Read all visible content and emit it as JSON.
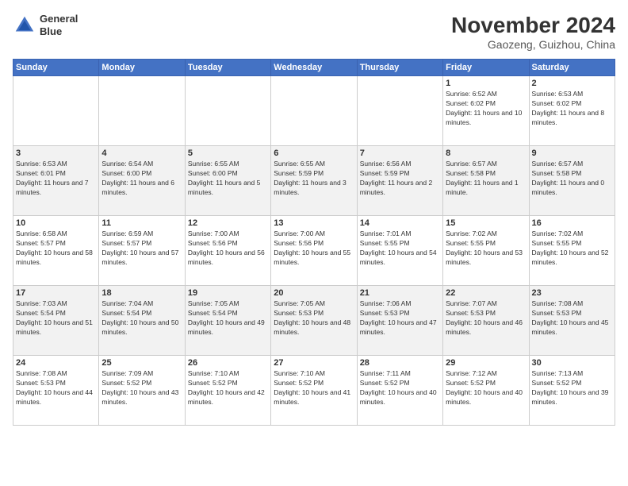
{
  "header": {
    "logo_line1": "General",
    "logo_line2": "Blue",
    "month": "November 2024",
    "location": "Gaozeng, Guizhou, China"
  },
  "weekdays": [
    "Sunday",
    "Monday",
    "Tuesday",
    "Wednesday",
    "Thursday",
    "Friday",
    "Saturday"
  ],
  "weeks": [
    [
      {
        "day": "",
        "info": ""
      },
      {
        "day": "",
        "info": ""
      },
      {
        "day": "",
        "info": ""
      },
      {
        "day": "",
        "info": ""
      },
      {
        "day": "",
        "info": ""
      },
      {
        "day": "1",
        "info": "Sunrise: 6:52 AM\nSunset: 6:02 PM\nDaylight: 11 hours and 10 minutes."
      },
      {
        "day": "2",
        "info": "Sunrise: 6:53 AM\nSunset: 6:02 PM\nDaylight: 11 hours and 8 minutes."
      }
    ],
    [
      {
        "day": "3",
        "info": "Sunrise: 6:53 AM\nSunset: 6:01 PM\nDaylight: 11 hours and 7 minutes."
      },
      {
        "day": "4",
        "info": "Sunrise: 6:54 AM\nSunset: 6:00 PM\nDaylight: 11 hours and 6 minutes."
      },
      {
        "day": "5",
        "info": "Sunrise: 6:55 AM\nSunset: 6:00 PM\nDaylight: 11 hours and 5 minutes."
      },
      {
        "day": "6",
        "info": "Sunrise: 6:55 AM\nSunset: 5:59 PM\nDaylight: 11 hours and 3 minutes."
      },
      {
        "day": "7",
        "info": "Sunrise: 6:56 AM\nSunset: 5:59 PM\nDaylight: 11 hours and 2 minutes."
      },
      {
        "day": "8",
        "info": "Sunrise: 6:57 AM\nSunset: 5:58 PM\nDaylight: 11 hours and 1 minute."
      },
      {
        "day": "9",
        "info": "Sunrise: 6:57 AM\nSunset: 5:58 PM\nDaylight: 11 hours and 0 minutes."
      }
    ],
    [
      {
        "day": "10",
        "info": "Sunrise: 6:58 AM\nSunset: 5:57 PM\nDaylight: 10 hours and 58 minutes."
      },
      {
        "day": "11",
        "info": "Sunrise: 6:59 AM\nSunset: 5:57 PM\nDaylight: 10 hours and 57 minutes."
      },
      {
        "day": "12",
        "info": "Sunrise: 7:00 AM\nSunset: 5:56 PM\nDaylight: 10 hours and 56 minutes."
      },
      {
        "day": "13",
        "info": "Sunrise: 7:00 AM\nSunset: 5:56 PM\nDaylight: 10 hours and 55 minutes."
      },
      {
        "day": "14",
        "info": "Sunrise: 7:01 AM\nSunset: 5:55 PM\nDaylight: 10 hours and 54 minutes."
      },
      {
        "day": "15",
        "info": "Sunrise: 7:02 AM\nSunset: 5:55 PM\nDaylight: 10 hours and 53 minutes."
      },
      {
        "day": "16",
        "info": "Sunrise: 7:02 AM\nSunset: 5:55 PM\nDaylight: 10 hours and 52 minutes."
      }
    ],
    [
      {
        "day": "17",
        "info": "Sunrise: 7:03 AM\nSunset: 5:54 PM\nDaylight: 10 hours and 51 minutes."
      },
      {
        "day": "18",
        "info": "Sunrise: 7:04 AM\nSunset: 5:54 PM\nDaylight: 10 hours and 50 minutes."
      },
      {
        "day": "19",
        "info": "Sunrise: 7:05 AM\nSunset: 5:54 PM\nDaylight: 10 hours and 49 minutes."
      },
      {
        "day": "20",
        "info": "Sunrise: 7:05 AM\nSunset: 5:53 PM\nDaylight: 10 hours and 48 minutes."
      },
      {
        "day": "21",
        "info": "Sunrise: 7:06 AM\nSunset: 5:53 PM\nDaylight: 10 hours and 47 minutes."
      },
      {
        "day": "22",
        "info": "Sunrise: 7:07 AM\nSunset: 5:53 PM\nDaylight: 10 hours and 46 minutes."
      },
      {
        "day": "23",
        "info": "Sunrise: 7:08 AM\nSunset: 5:53 PM\nDaylight: 10 hours and 45 minutes."
      }
    ],
    [
      {
        "day": "24",
        "info": "Sunrise: 7:08 AM\nSunset: 5:53 PM\nDaylight: 10 hours and 44 minutes."
      },
      {
        "day": "25",
        "info": "Sunrise: 7:09 AM\nSunset: 5:52 PM\nDaylight: 10 hours and 43 minutes."
      },
      {
        "day": "26",
        "info": "Sunrise: 7:10 AM\nSunset: 5:52 PM\nDaylight: 10 hours and 42 minutes."
      },
      {
        "day": "27",
        "info": "Sunrise: 7:10 AM\nSunset: 5:52 PM\nDaylight: 10 hours and 41 minutes."
      },
      {
        "day": "28",
        "info": "Sunrise: 7:11 AM\nSunset: 5:52 PM\nDaylight: 10 hours and 40 minutes."
      },
      {
        "day": "29",
        "info": "Sunrise: 7:12 AM\nSunset: 5:52 PM\nDaylight: 10 hours and 40 minutes."
      },
      {
        "day": "30",
        "info": "Sunrise: 7:13 AM\nSunset: 5:52 PM\nDaylight: 10 hours and 39 minutes."
      }
    ]
  ]
}
